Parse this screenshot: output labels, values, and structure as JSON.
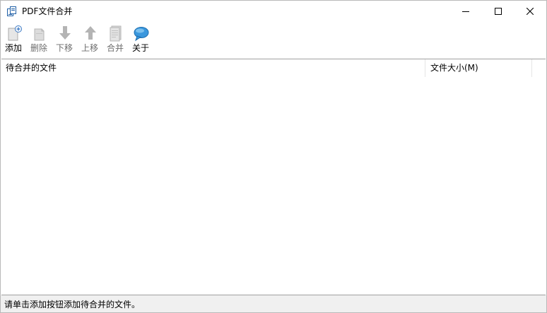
{
  "window": {
    "title": "PDF文件合并"
  },
  "toolbar": {
    "add_label": "添加",
    "delete_label": "删除",
    "move_down_label": "下移",
    "move_up_label": "上移",
    "merge_label": "合并",
    "about_label": "关于"
  },
  "list": {
    "columns": [
      "待合并的文件",
      "文件大小(M)"
    ]
  },
  "status": {
    "text": "请单击添加按钮添加待合并的文件。"
  },
  "colors": {
    "disabled_icon": "#b4b4b4",
    "about_icon": "#2f8fd8",
    "add_icon_plus": "#3a78c4"
  },
  "icons": {
    "app": "pdf-merge-icon",
    "add": "add-file-icon",
    "delete": "delete-file-icon",
    "move_down": "arrow-down-icon",
    "move_up": "arrow-up-icon",
    "merge": "merge-document-icon",
    "about": "speech-bubble-icon"
  }
}
